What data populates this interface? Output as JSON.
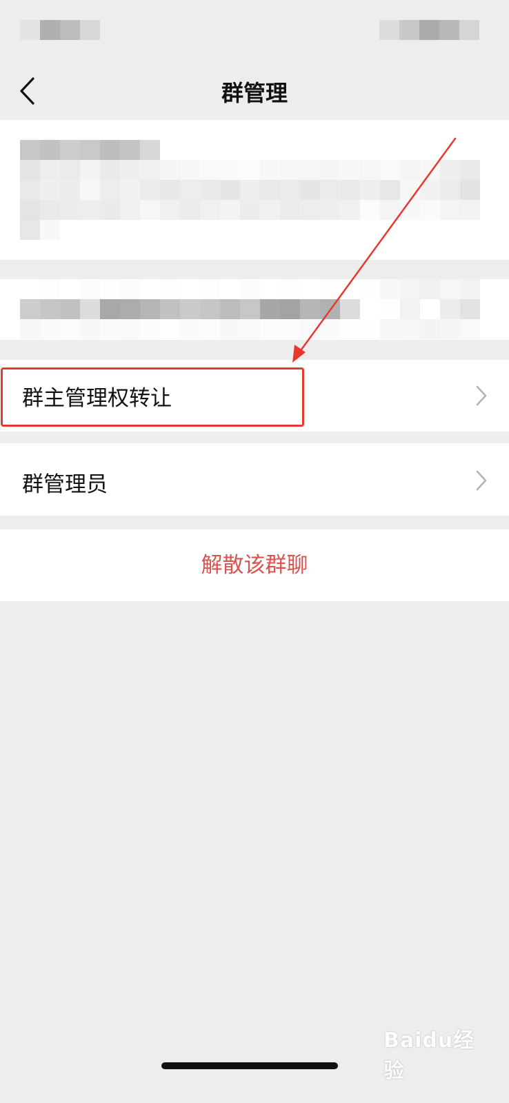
{
  "nav": {
    "title": "群管理",
    "back_icon": "back-chevron-icon"
  },
  "settings": {
    "items": [
      {
        "label": "群主管理权转让",
        "icon": "chevron-right-icon"
      },
      {
        "label": "群管理员",
        "icon": "chevron-right-icon"
      }
    ],
    "dissolve_label": "解散该群聊"
  },
  "colors": {
    "background": "#ededed",
    "card": "#ffffff",
    "danger_text": "#d9534f",
    "annotation": "#e8372d"
  },
  "watermark": {
    "text": "Baidu经验"
  }
}
